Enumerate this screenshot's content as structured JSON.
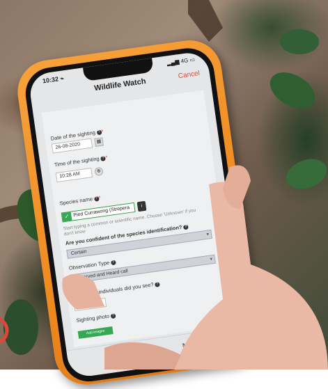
{
  "status_bar": {
    "time": "10:32 ⌁",
    "signal": "4G"
  },
  "header": {
    "title": "Wildlife Watch",
    "cancel_label": "Cancel"
  },
  "form": {
    "date_label": "Date of the sighting",
    "date_value": "26-08-2020",
    "time_label": "Time of the sighting",
    "time_value": "10:28 AM",
    "species_label": "Species name",
    "species_value": "Pied Currawong (Strepera",
    "species_hint": "Start typing a common or scientific name. Choose 'Unknown' if you don't know",
    "confidence_label": "Are you confident of the species identification?",
    "confidence_value": "Certain",
    "observation_label": "Observation Type",
    "observation_value": "Observed and Heard call",
    "count_label": "How many individuals did you see?",
    "count_value": "1",
    "photos_label": "Sighting photo",
    "add_photo_label": "Add images"
  },
  "colors": {
    "case": "#ee8a1f",
    "accent_red": "#e0453b",
    "accent_green": "#34a853"
  },
  "icons": [
    "calendar-icon",
    "location-icon",
    "info-icon",
    "help-icon",
    "refresh-icon",
    "share-icon"
  ]
}
